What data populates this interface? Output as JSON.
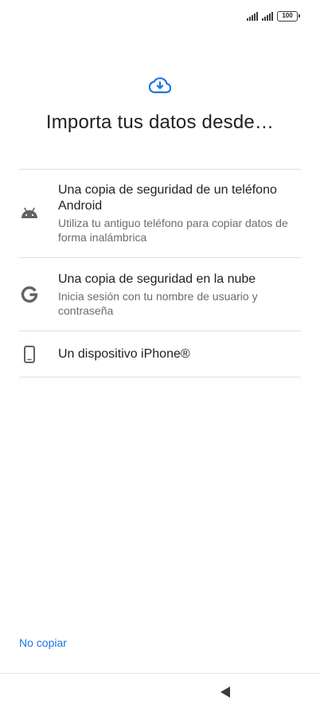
{
  "status_bar": {
    "battery_level": "100",
    "icons": [
      "signal-1-icon",
      "signal-2-icon",
      "battery-icon"
    ]
  },
  "header": {
    "icon": "cloud-download-icon",
    "title": "Importa tus datos desde…"
  },
  "options": [
    {
      "icon": "android-icon",
      "title": "Una copia de seguridad de un teléfono Android",
      "subtitle": "Utiliza tu antiguo teléfono para copiar datos de forma inalámbrica"
    },
    {
      "icon": "google-icon",
      "title": "Una copia de seguridad en la nube",
      "subtitle": "Inicia sesión con tu nombre de usuario y contraseña"
    },
    {
      "icon": "phone-icon",
      "title": "Un dispositivo iPhone®",
      "subtitle": ""
    }
  ],
  "footer": {
    "skip_label": "No copiar"
  },
  "nav": {
    "back_icon": "back-triangle-icon"
  },
  "colors": {
    "accent": "#1a73e8",
    "icon_gray": "#5f6368",
    "divider": "#e0e0e0"
  }
}
